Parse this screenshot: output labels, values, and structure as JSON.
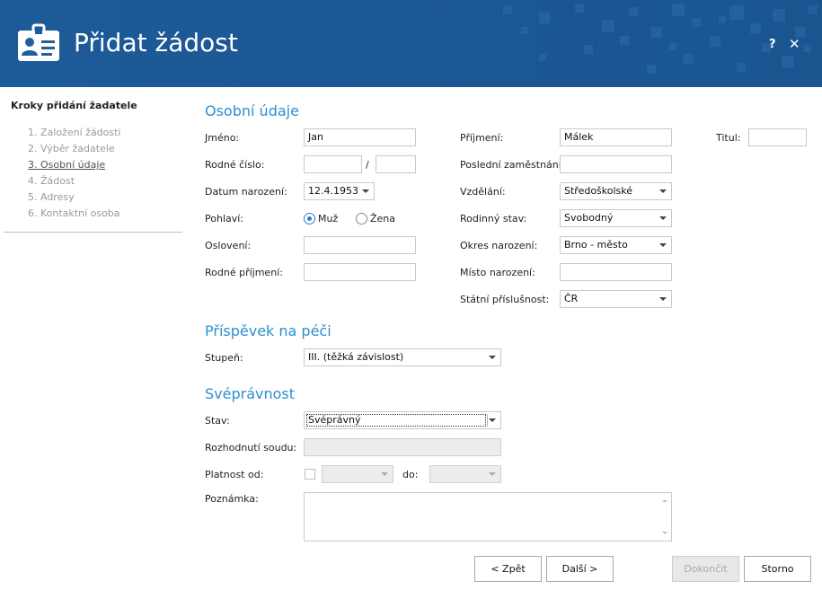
{
  "window": {
    "title": "Přidat žádost",
    "help_label": "?",
    "close_label": "✕",
    "brand_color": "#1f5f9e",
    "accent_color": "#2d8fcf"
  },
  "sidebar": {
    "title": "Kroky přidání žadatele",
    "steps": [
      {
        "label": "1. Založení žádosti"
      },
      {
        "label": "2. Výběr žadatele"
      },
      {
        "label": "3. Osobní údaje",
        "active": true
      },
      {
        "label": "4. Žádost"
      },
      {
        "label": "5. Adresy"
      },
      {
        "label": "6. Kontaktní osoba"
      }
    ]
  },
  "osobni": {
    "title": "Osobní údaje",
    "jmeno": {
      "label": "Jméno:",
      "value": "Jan"
    },
    "prijmeni": {
      "label": "Příjmení:",
      "value": "Málek"
    },
    "titul": {
      "label": "Titul:",
      "value": ""
    },
    "rodne_cislo": {
      "label": "Rodné číslo:",
      "part1": "",
      "separator": "/",
      "part2": ""
    },
    "posledni_zamestnani": {
      "label": "Poslední zaměstnání:",
      "value": ""
    },
    "datum_narozeni": {
      "label": "Datum narození:",
      "value": "12.4.1953"
    },
    "vzdelani": {
      "label": "Vzdělání:",
      "value": "Středoškolské"
    },
    "pohlavi": {
      "label": "Pohlaví:",
      "option_male": "Muž",
      "option_female": "Žena",
      "selected": "Muž"
    },
    "rodinny_stav": {
      "label": "Rodinný stav:",
      "value": "Svobodný"
    },
    "osloveni": {
      "label": "Oslovení:",
      "value": ""
    },
    "okres_narozeni": {
      "label": "Okres narození:",
      "value": "Brno - město"
    },
    "rodne_prijmeni": {
      "label": "Rodné příjmení:",
      "value": ""
    },
    "misto_narozeni": {
      "label": "Místo narození:",
      "value": ""
    },
    "statni_prislusnost": {
      "label": "Státní příslušnost:",
      "value": "ČR"
    }
  },
  "prispevek": {
    "title": "Příspěvek na péči",
    "stupen": {
      "label": "Stupeň:",
      "value": "III. (těžká závislost)"
    }
  },
  "svepravnost": {
    "title": "Svéprávnost",
    "stav": {
      "label": "Stav:",
      "value": "Svéprávný"
    },
    "rozhodnuti_soudu": {
      "label": "Rozhodnutí soudu:",
      "value": ""
    },
    "platnost_od": {
      "label": "Platnost od:",
      "from_value": "",
      "to_label": "do:",
      "to_value": ""
    },
    "poznamka": {
      "label": "Poznámka:",
      "value": ""
    }
  },
  "buttons": {
    "back": "< Zpět",
    "next": "Další >",
    "finish": "Dokončit",
    "cancel": "Storno"
  }
}
